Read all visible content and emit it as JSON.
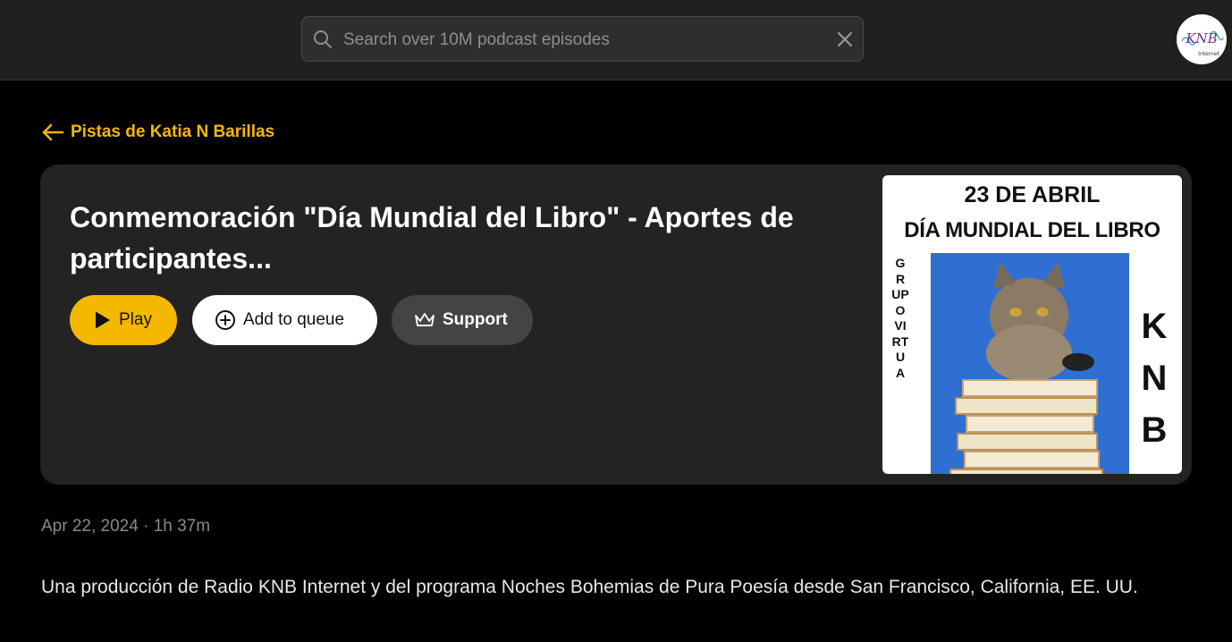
{
  "search": {
    "placeholder": "Search over 10M podcast episodes"
  },
  "back_link": {
    "label": "Pistas de Katia N Barillas"
  },
  "episode": {
    "title": "Conmemoración \"Día Mundial del Libro\" - Aportes de participantes...",
    "play_label": "Play",
    "queue_label": "Add to queue",
    "support_label": "Support",
    "date": "Apr 22, 2024",
    "separator": " · ",
    "duration": "1h 37m",
    "description": "Una producción de Radio KNB Internet y del programa Noches Bohemias de Pura Poesía desde San Francisco, California, EE. UU."
  },
  "cover": {
    "line1": "23 DE ABRIL",
    "line2": "DÍA MUNDIAL DEL LIBRO",
    "vertical_text": "GRUPO VIRTUA",
    "side_text": "KNB"
  },
  "avatar": {
    "logo_text": "KNB",
    "logo_subtext": "Internet"
  },
  "colors": {
    "accent": "#f5b800",
    "background": "#000000",
    "topbar": "#202020",
    "card": "#232323"
  },
  "icons": {
    "search": "search-icon",
    "clear": "close-icon",
    "back": "arrow-left-icon",
    "play": "play-icon",
    "queue": "plus-circle-icon",
    "support": "crown-icon"
  }
}
